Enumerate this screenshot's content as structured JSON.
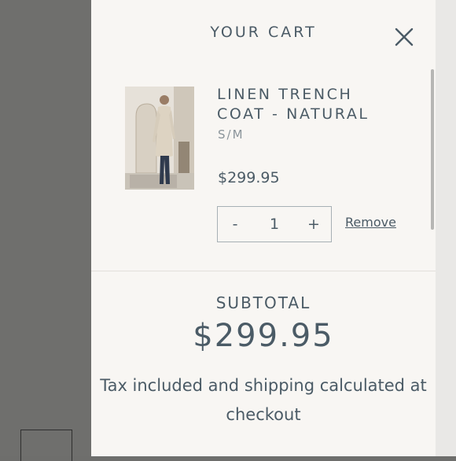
{
  "cart": {
    "title": "YOUR CART",
    "close_icon": "close-icon"
  },
  "item": {
    "name": "LINEN TRENCH COAT - NATURAL",
    "variant": "S/M",
    "price": "$299.95",
    "quantity": "1",
    "decrease_label": "-",
    "increase_label": "+",
    "remove_label": "Remove"
  },
  "summary": {
    "subtotal_label": "SUBTOTAL",
    "subtotal_value": "$299.95",
    "tax_note": "Tax included and shipping calculated at checkout"
  },
  "colors": {
    "panel_bg": "#f8f6f3",
    "text": "#4b5b66",
    "overlay": "#6e6e6c"
  }
}
